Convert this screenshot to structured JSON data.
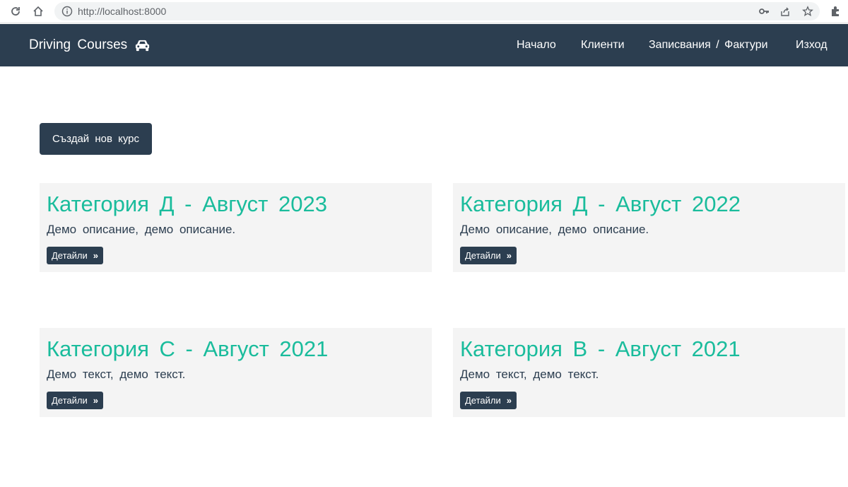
{
  "browser": {
    "url": "http://localhost:8000"
  },
  "navbar": {
    "brand": "Driving Courses",
    "brand_icon": "car-icon",
    "links": [
      {
        "label": "Начало"
      },
      {
        "label": "Клиенти"
      },
      {
        "label": "Записвания / Фактури"
      },
      {
        "label": "Изход"
      }
    ]
  },
  "main": {
    "create_label": "Създай нов курс",
    "courses": [
      {
        "title": "Категория Д - Август 2023",
        "description": "Демо описание, демо описание.",
        "details_label": "Детайли",
        "details_arrow": "»"
      },
      {
        "title": "Категория Д - Август 2022",
        "description": "Демо описание, демо описание.",
        "details_label": "Детайли",
        "details_arrow": "»"
      },
      {
        "title": "Категория C - Август 2021",
        "description": "Демо текст, демо текст.",
        "details_label": "Детайли",
        "details_arrow": "»"
      },
      {
        "title": "Категория B - Август 2021",
        "description": "Демо текст, демо текст.",
        "details_label": "Детайли",
        "details_arrow": "»"
      }
    ]
  },
  "colors": {
    "navbar_bg": "#2c3e50",
    "accent": "#1abc9c",
    "card_bg": "#f4f4f4"
  }
}
